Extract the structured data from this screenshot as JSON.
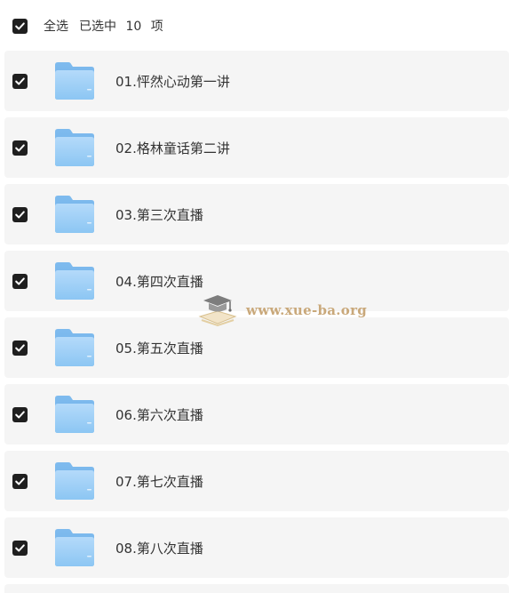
{
  "header": {
    "select_all_label": "全选",
    "selected_prefix": "已选中",
    "selected_count": "10",
    "selected_suffix": "项"
  },
  "files": [
    {
      "name": "01.怦然心动第一讲",
      "checked": true
    },
    {
      "name": "02.格林童话第二讲",
      "checked": true
    },
    {
      "name": "03.第三次直播",
      "checked": true
    },
    {
      "name": "04.第四次直播",
      "checked": true
    },
    {
      "name": "05.第五次直播",
      "checked": true
    },
    {
      "name": "06.第六次直播",
      "checked": true
    },
    {
      "name": "07.第七次直播",
      "checked": true
    },
    {
      "name": "08.第八次直播",
      "checked": true
    }
  ],
  "watermark": {
    "text": "www.xue-ba.org"
  },
  "colors": {
    "checkbox": "#1f1f1f",
    "row_background": "#f5f5f5",
    "folder_light": "#a9d4f7",
    "folder_dark": "#7fbbee",
    "watermark": "#c9a87a"
  },
  "icons": {
    "checkbox": "checkbox-checked-icon",
    "folder": "folder-icon",
    "watermark_logo": "graduation-cap-icon"
  }
}
